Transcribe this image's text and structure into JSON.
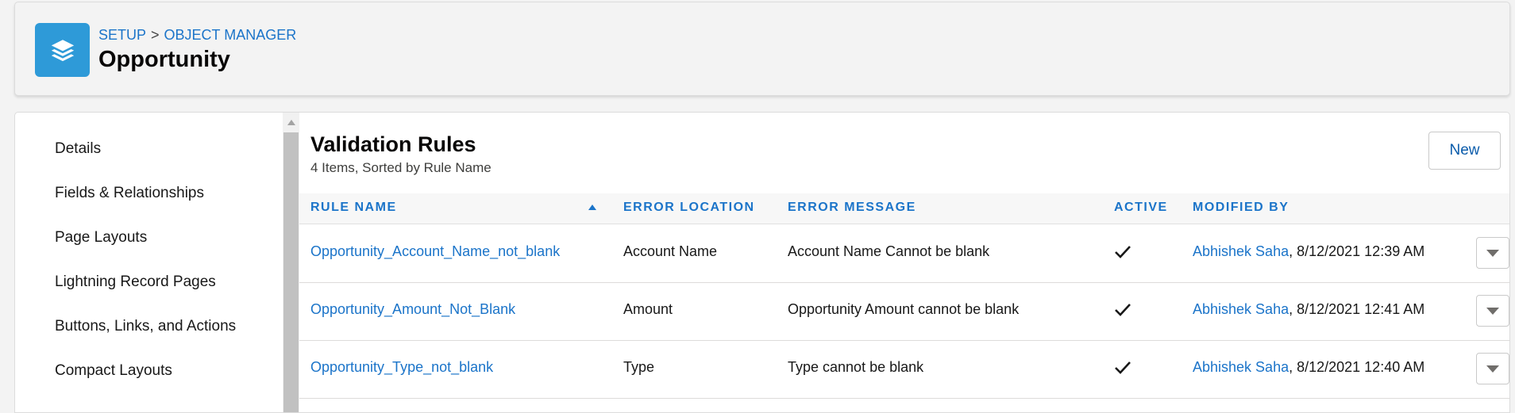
{
  "header": {
    "breadcrumb": {
      "setup": "SETUP",
      "separator": ">",
      "object_manager": "OBJECT MANAGER"
    },
    "title": "Opportunity",
    "icon": "layers-icon",
    "icon_color": "#2e9ad8"
  },
  "sidebar": {
    "items": [
      {
        "label": "Details"
      },
      {
        "label": "Fields & Relationships"
      },
      {
        "label": "Page Layouts"
      },
      {
        "label": "Lightning Record Pages"
      },
      {
        "label": "Buttons, Links, and Actions"
      },
      {
        "label": "Compact Layouts"
      }
    ]
  },
  "main": {
    "title": "Validation Rules",
    "subtitle": "4 Items, Sorted by Rule Name",
    "new_button": "New",
    "columns": {
      "rule_name": "RULE NAME",
      "error_location": "ERROR LOCATION",
      "error_message": "ERROR MESSAGE",
      "active": "ACTIVE",
      "modified_by": "MODIFIED BY"
    },
    "rows": [
      {
        "rule_name": "Opportunity_Account_Name_not_blank",
        "error_location": "Account Name",
        "error_message": "Account Name Cannot be blank",
        "active": true,
        "modified_by_user": "Abhishek Saha",
        "modified_by_date": ", 8/12/2021 12:39 AM"
      },
      {
        "rule_name": "Opportunity_Amount_Not_Blank",
        "error_location": "Amount",
        "error_message": "Opportunity Amount cannot be blank",
        "active": true,
        "modified_by_user": "Abhishek Saha",
        "modified_by_date": ", 8/12/2021 12:41 AM"
      },
      {
        "rule_name": "Opportunity_Type_not_blank",
        "error_location": "Type",
        "error_message": "Type cannot be blank",
        "active": true,
        "modified_by_user": "Abhishek Saha",
        "modified_by_date": ", 8/12/2021 12:40 AM"
      }
    ]
  },
  "colors": {
    "link": "#1b74c9",
    "accent": "#2e9ad8"
  }
}
